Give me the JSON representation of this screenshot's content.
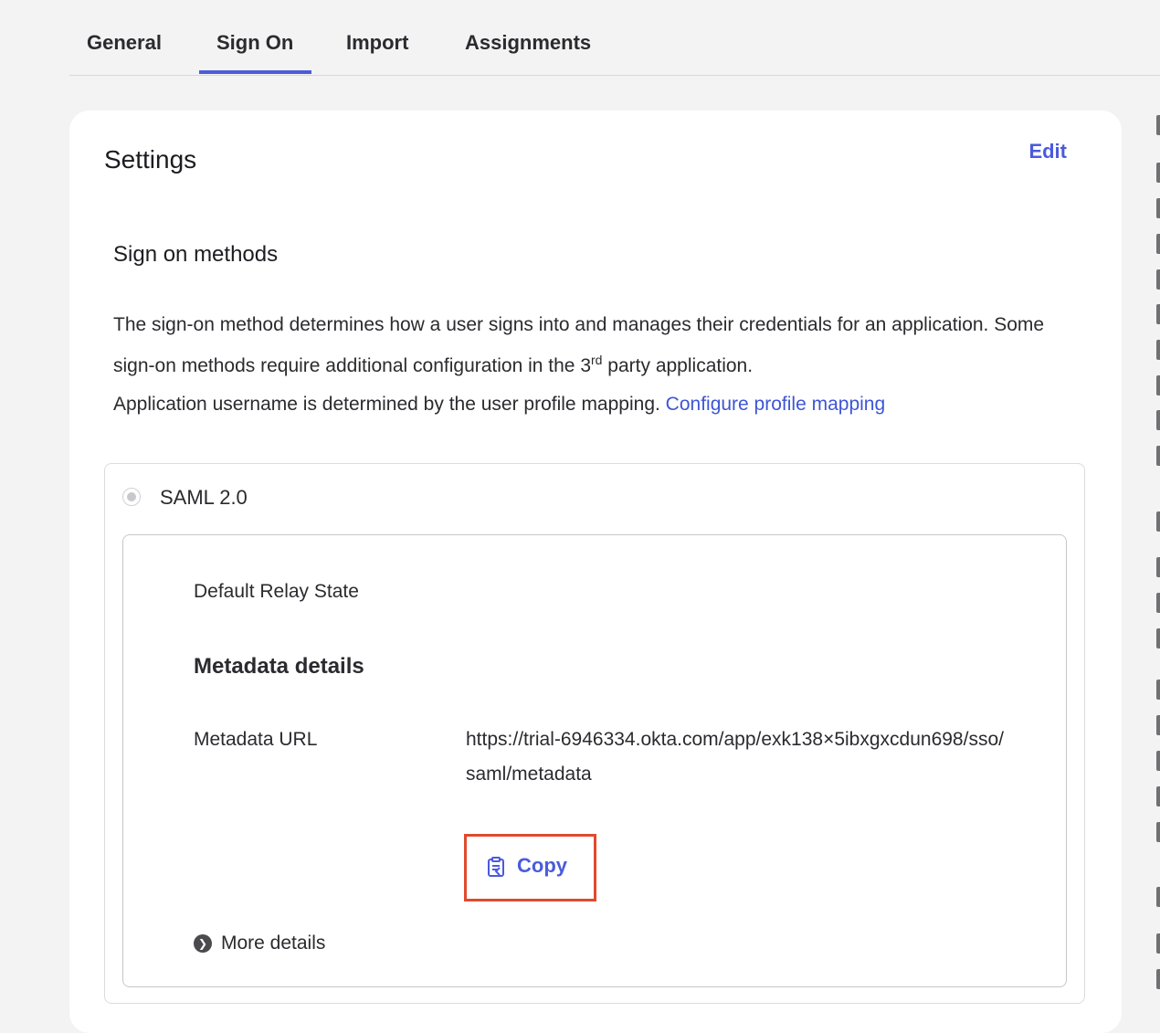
{
  "tabs": [
    {
      "label": "General"
    },
    {
      "label": "Sign On",
      "active": true
    },
    {
      "label": "Import"
    },
    {
      "label": "Assignments"
    }
  ],
  "settings": {
    "title": "Settings",
    "edit_label": "Edit"
  },
  "sign_on": {
    "section_title": "Sign on methods",
    "desc_part1": "The sign-on method determines how a user signs into and manages their credentials for an application. Some sign-on methods require additional configuration in the 3",
    "desc_sup": "rd",
    "desc_part2": " party application.",
    "profile_text": "Application username is determined by the user profile mapping.",
    "profile_link": "Configure profile mapping"
  },
  "saml": {
    "label": "SAML 2.0",
    "relay_label": "Default Relay State",
    "metadata_title": "Metadata details",
    "metadata_url_label": "Metadata URL",
    "metadata_url": "https://trial-6946334.okta.com/app/exk138×5ibxgxcdun698/sso/saml/metadata",
    "copy_label": "Copy",
    "more_details_label": "More details"
  },
  "colors": {
    "accent": "#4a5bdc",
    "highlight_box": "#e04a2d"
  },
  "icons": {
    "copy": "clipboard-icon",
    "more": "chevron-right-circle-icon",
    "radio": "radio-selected-disabled"
  }
}
